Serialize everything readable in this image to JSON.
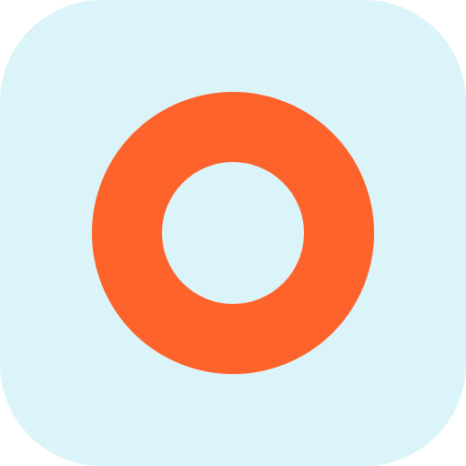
{
  "app_icon": {
    "icon_name": "ring-logo-icon",
    "colors": {
      "background": "#DAF4F9",
      "ring": "#FF632C"
    }
  }
}
